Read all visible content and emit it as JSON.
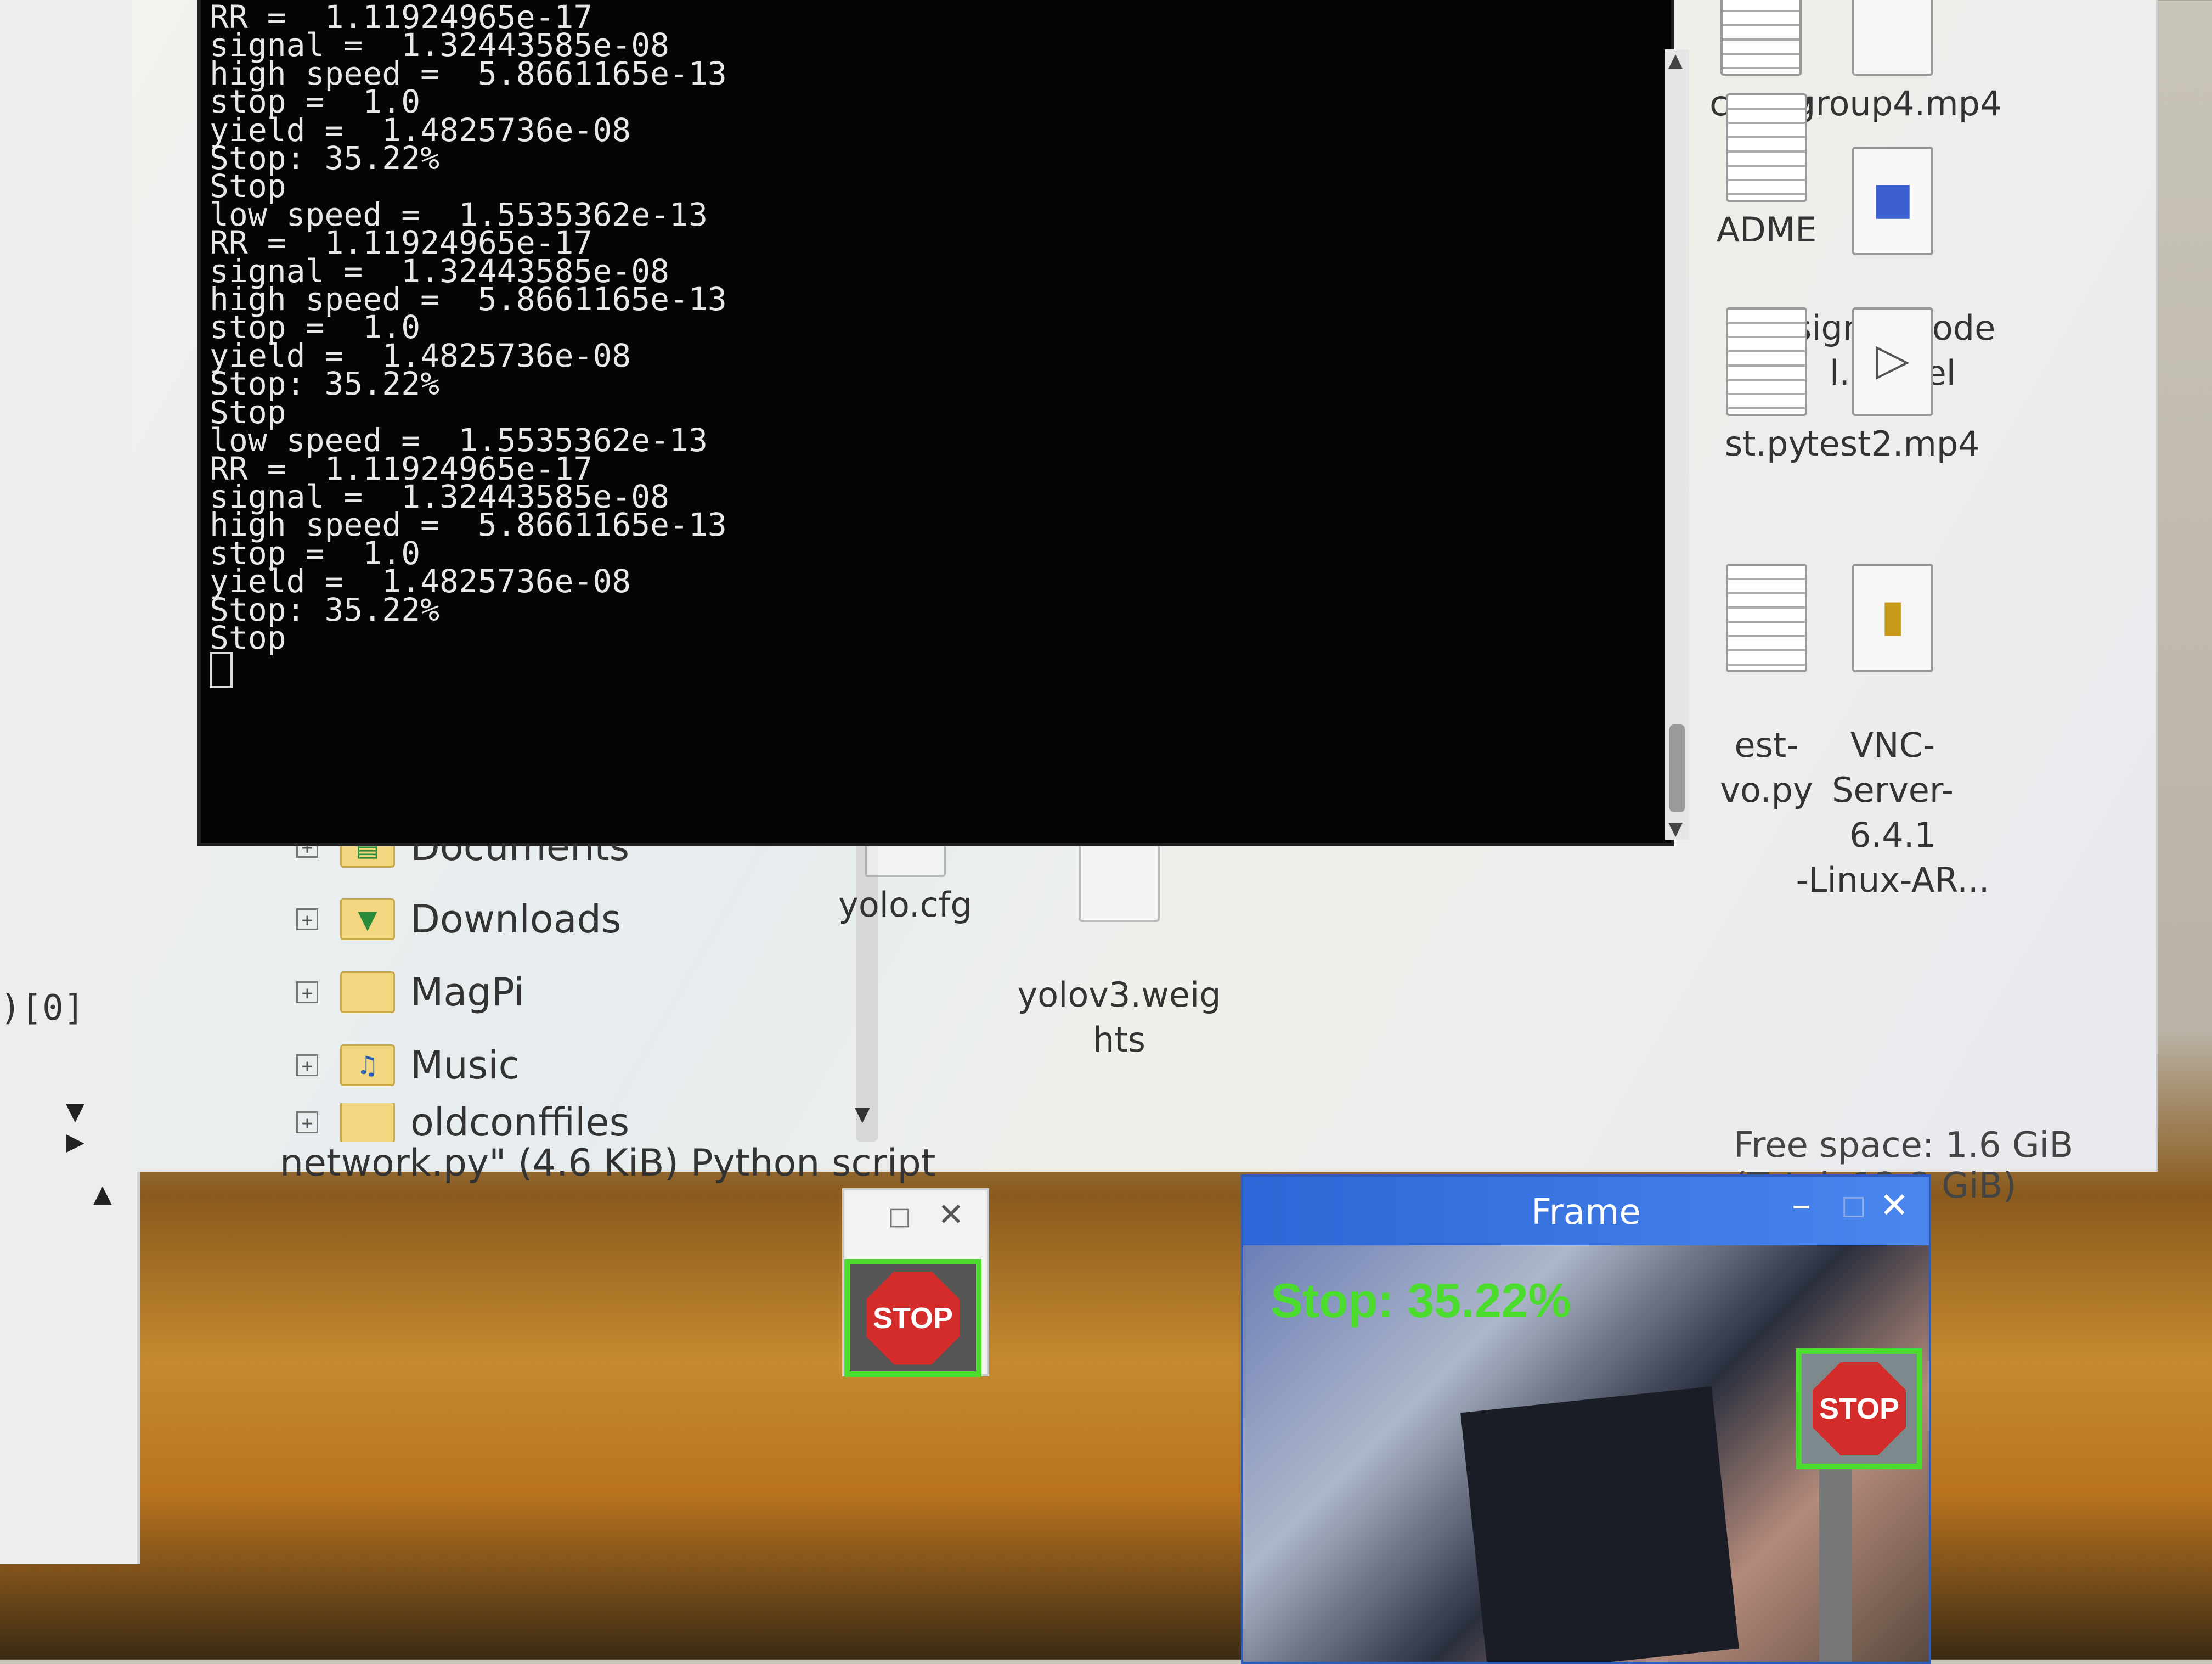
{
  "terminal": {
    "lines": [
      "RR =  1.11924965e-17",
      "signal =  1.32443585e-08",
      "high speed =  5.8661165e-13",
      "stop =  1.0",
      "yield =  1.4825736e-08",
      "Stop: 35.22%",
      "Stop",
      "low speed =  1.5535362e-13",
      "RR =  1.11924965e-17",
      "signal =  1.32443585e-08",
      "high speed =  5.8661165e-13",
      "stop =  1.0",
      "yield =  1.4825736e-08",
      "Stop: 35.22%",
      "Stop",
      "low speed =  1.5535362e-13",
      "RR =  1.11924965e-17",
      "signal =  1.32443585e-08",
      "high speed =  5.8661165e-13",
      "stop =  1.0",
      "yield =  1.4825736e-08",
      "Stop: 35.22%",
      "Stop"
    ]
  },
  "file_manager": {
    "tree": [
      {
        "label": "Documents",
        "icon": "documents-folder-icon"
      },
      {
        "label": "Downloads",
        "icon": "downloads-folder-icon"
      },
      {
        "label": "MagPi",
        "icon": "folder-icon"
      },
      {
        "label": "Music",
        "icon": "music-folder-icon"
      },
      {
        "label": "oldconffiles",
        "icon": "folder-icon"
      }
    ],
    "files": [
      {
        "name": "car.py"
      },
      {
        "name": "group4.mp4"
      },
      {
        "name": "ADME"
      },
      {
        "name": "signs_mode\nl.model"
      },
      {
        "name": "st.py"
      },
      {
        "name": "test2.mp4"
      },
      {
        "name": "est-\nvo.py"
      },
      {
        "name": "VNC-\nServer-6.4.1\n-Linux-AR..."
      },
      {
        "name": "yolo.cfg"
      },
      {
        "name": "yolov3.weig\nhts"
      }
    ],
    "status_left": "network.py\" (4.6 KiB) Python script",
    "status_right": "Free space: 1.6 GiB (Total: 12.8 GiB)"
  },
  "side_code": ")[0]",
  "small_window": {
    "max_glyph": "□",
    "close_glyph": "✕",
    "sign_text": "STOP"
  },
  "frame_window": {
    "title": "Frame",
    "min_glyph": "–",
    "max_glyph": "□",
    "close_glyph": "✕",
    "overlay": "Stop: 35.22%",
    "sign_text": "STOP"
  },
  "colors": {
    "detection_box": "#4bdc2e",
    "title_bar": "#2d66d6",
    "terminal_bg": "#050505"
  }
}
